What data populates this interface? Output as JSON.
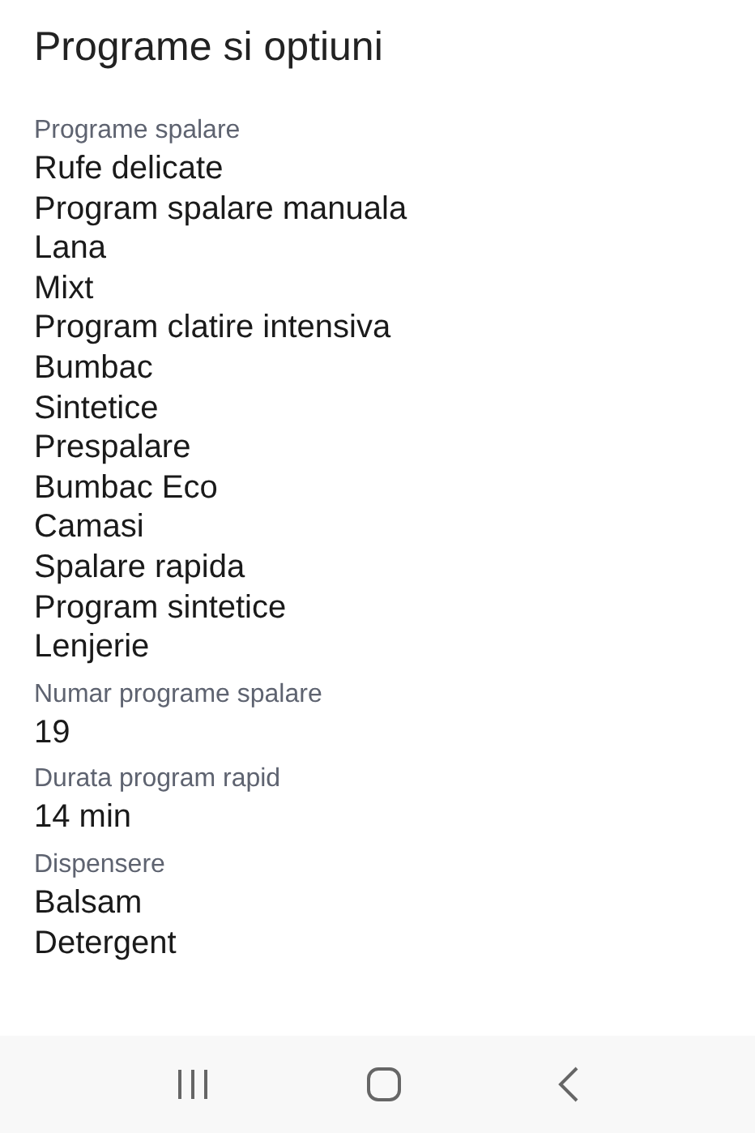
{
  "title": "Programe si optiuni",
  "sections": [
    {
      "label": "Programe spalare",
      "values": [
        "Rufe delicate",
        "Program spalare manuala",
        "Lana",
        "Mixt",
        "Program clatire intensiva",
        "Bumbac",
        "Sintetice",
        "Prespalare",
        "Bumbac Eco",
        "Camasi",
        "Spalare rapida",
        "Program sintetice",
        "Lenjerie"
      ]
    },
    {
      "label": "Numar programe spalare",
      "values": [
        "19"
      ]
    },
    {
      "label": "Durata program rapid",
      "values": [
        "14 min"
      ]
    },
    {
      "label": "Dispensere",
      "values": [
        "Balsam",
        "Detergent"
      ]
    }
  ]
}
